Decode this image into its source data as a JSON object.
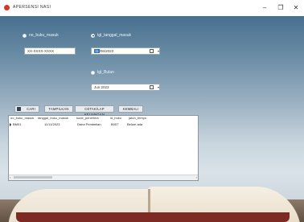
{
  "window": {
    "title": "APERSENSI NASI",
    "minimize": "–",
    "maximize": "❐",
    "close": "✕"
  },
  "colors": {
    "accent": "#2f6fc4",
    "app_icon": "#d9342b"
  },
  "form": {
    "radio_left": {
      "label": "no_buku_masuk",
      "checked": false
    },
    "radio_right": {
      "label": "tgl_tanggal_masuk",
      "checked": true
    },
    "radio_bottom": {
      "label": "tgl_Bulan",
      "checked": false
    },
    "text_value": "XX-XXXX-XXXX",
    "date1": {
      "selected": "11",
      "rest": "/06/2023"
    },
    "date2": {
      "value": "Jun 2023"
    },
    "buttons": {
      "cari": "CARI",
      "tampilkan": "TAMPILKAN",
      "cetak": "CETAK/LAP KEUANGAN",
      "tutup": "KEMBALI"
    }
  },
  "grid": {
    "columns": [
      "no_buku_masuk",
      "tanggal_buku_masuk",
      "kode_penerima",
      "id_buku",
      "jatuh_tempo"
    ],
    "rows": [
      [
        "BM01",
        "11/11/2023",
        "Dana Pembelian",
        "B007",
        "Belum ada"
      ]
    ],
    "scroll_left": "‹",
    "scroll_right": "›"
  }
}
